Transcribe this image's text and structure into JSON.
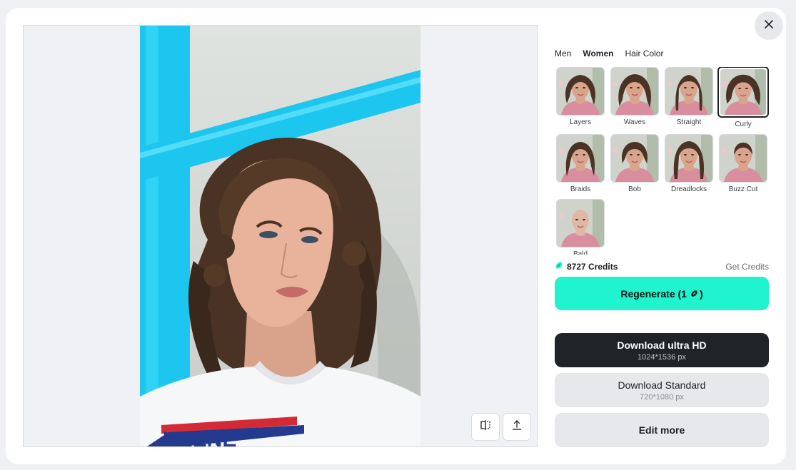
{
  "tabs": [
    {
      "label": "Men",
      "active": false
    },
    {
      "label": "Women",
      "active": true
    },
    {
      "label": "Hair Color",
      "active": false
    }
  ],
  "styles": [
    {
      "label": "Layers",
      "selected": false
    },
    {
      "label": "Waves",
      "selected": false
    },
    {
      "label": "Straight",
      "selected": false
    },
    {
      "label": "Curly",
      "selected": true
    },
    {
      "label": "Braids",
      "selected": false
    },
    {
      "label": "Bob",
      "selected": false
    },
    {
      "label": "Dreadlocks",
      "selected": false
    },
    {
      "label": "Buzz Cut",
      "selected": false
    },
    {
      "label": "Bald",
      "selected": false
    }
  ],
  "credits": {
    "amount": "8727 Credits",
    "get_label": "Get Credits",
    "color": "#1ff4cf"
  },
  "actions": {
    "regenerate_label": "Regenerate (1",
    "regenerate_suffix": ")",
    "download_uhd_label": "Download ultra HD",
    "download_uhd_size": "1024*1536 px",
    "download_std_label": "Download Standard",
    "download_std_size": "720*1080 px",
    "edit_more_label": "Edit more"
  },
  "preview": {
    "shirt_text": "UEENE"
  },
  "icons": {
    "close": "close-icon",
    "compare": "compare-icon",
    "share": "share-icon",
    "credit": "credit-bean-icon"
  }
}
